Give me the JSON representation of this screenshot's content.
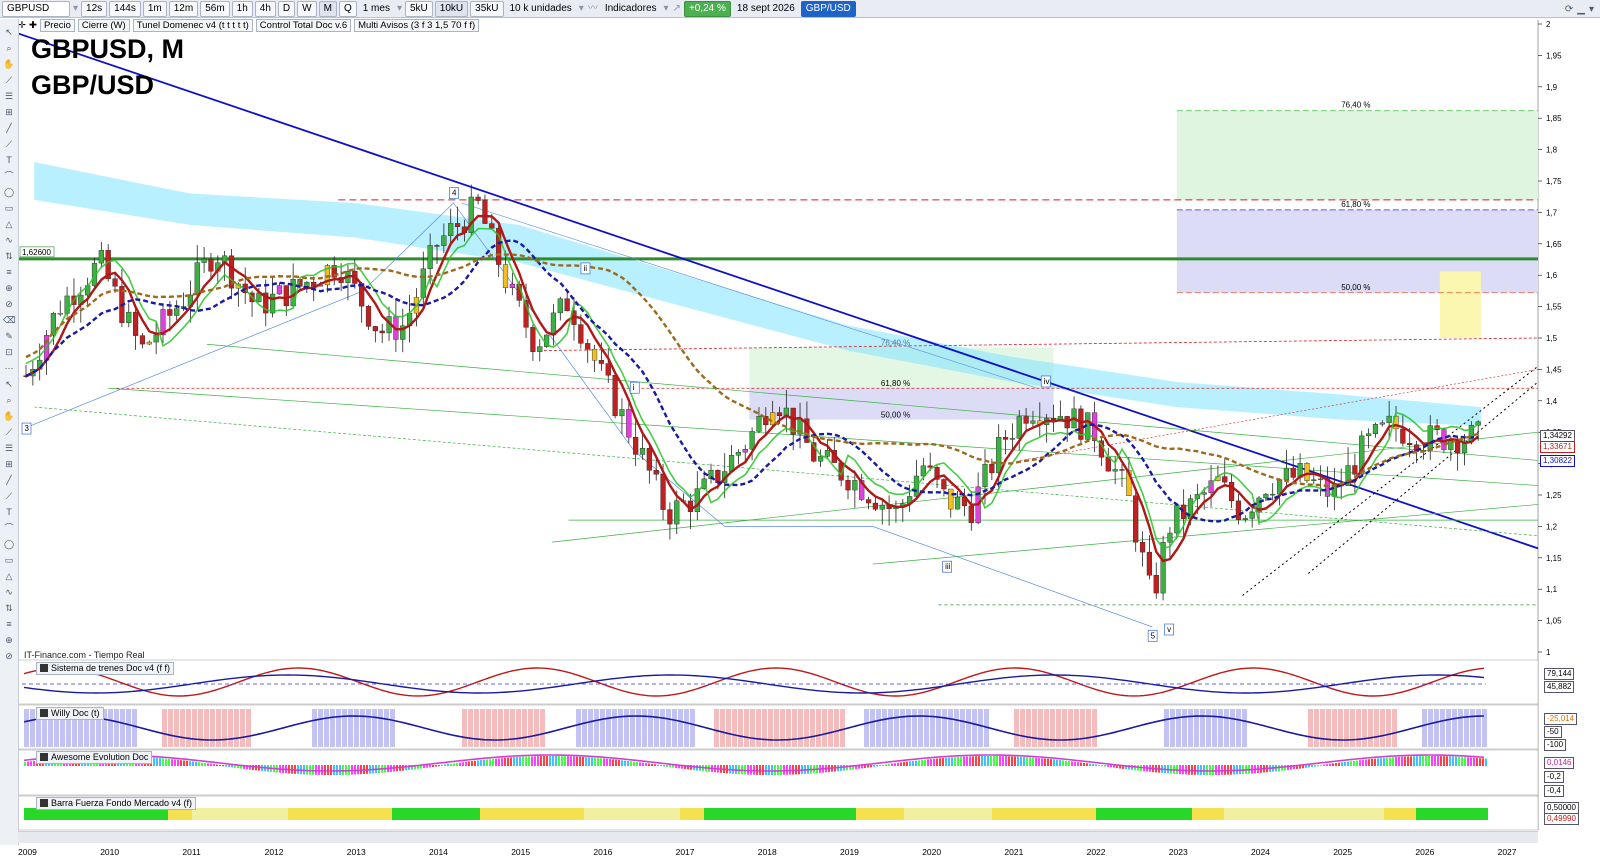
{
  "toolbar": {
    "symbol": "GBPUSD",
    "timeframes": [
      "12s",
      "144s",
      "1m",
      "12m",
      "56m",
      "1h",
      "4h",
      "D",
      "W",
      "M",
      "Q"
    ],
    "selected_timeframe": "M",
    "period": "1 mes",
    "unit_buttons": [
      "5kU",
      "10kU",
      "35kU"
    ],
    "selected_unit": "10kU",
    "quantity": "10 k unidades",
    "indicators_label": "Indicadores",
    "change": "+0,24 %",
    "date": "18 sept 2026",
    "symbol_badge": "GBP/USD"
  },
  "legend": {
    "items": [
      "Precio",
      "Cierre (W)",
      "Tunel Domenec v4 (t t t t t)",
      "Control Total Doc v.6",
      "Multi Avisos (3 f 3 1,5 70 f f)"
    ]
  },
  "chart": {
    "title_line1": "GBPUSD, M",
    "title_line2": "GBP/USD",
    "source_note": "IT-Finance.com - Tiempo Real",
    "price_ticks": [
      "2",
      "1,95",
      "1,9",
      "1,85",
      "1,8",
      "1,75",
      "1,7",
      "1,65",
      "1,6",
      "1,55",
      "1,5",
      "1,45",
      "1,4",
      "1,35",
      "1,3",
      "1,25",
      "1,2",
      "1,15",
      "1,1",
      "1,05",
      "1"
    ],
    "hline_label": "1,62600",
    "fib_labels": [
      "76,40 %",
      "61,80 %",
      "50,00 %"
    ],
    "fib_labels_small": [
      "76,40 %",
      "61,80 %",
      "50,00 %"
    ],
    "wave_labels": [
      "3",
      "4",
      "5",
      "i",
      "ii",
      "iii",
      "iv",
      "v"
    ],
    "price_tags": [
      "1,34292",
      "1,33671",
      "1,30822"
    ],
    "x_labels": [
      "2009",
      "2010",
      "2011",
      "2012",
      "2013",
      "2014",
      "2015",
      "2016",
      "2017",
      "2018",
      "2019",
      "2020",
      "2021",
      "2022",
      "2023",
      "2024",
      "2025",
      "2026",
      "2027"
    ],
    "colors": {
      "up": "#3cb043",
      "down": "#c0201f",
      "trend": "#1010c8",
      "support": "#2e8b2e",
      "cloud": "#7fe3ff"
    }
  },
  "indicators": [
    {
      "title": "Sistema de trenes Doc v4 (f f)",
      "right_values": [
        "79,144",
        "45,882"
      ],
      "scale_top": "100",
      "scale_bottom": "0"
    },
    {
      "title": "Willy Doc (t)",
      "right_values": [
        "-25,014",
        "-50",
        "-100"
      ]
    },
    {
      "title": "Awesome Evolution Doc",
      "right_values": [
        "0,0146",
        "-0,2",
        "-0,4"
      ]
    },
    {
      "title": "Barra Fuerza Fondo Mercado v4 (f)",
      "right_values": [
        "0,50000",
        "0,49990"
      ]
    }
  ]
}
